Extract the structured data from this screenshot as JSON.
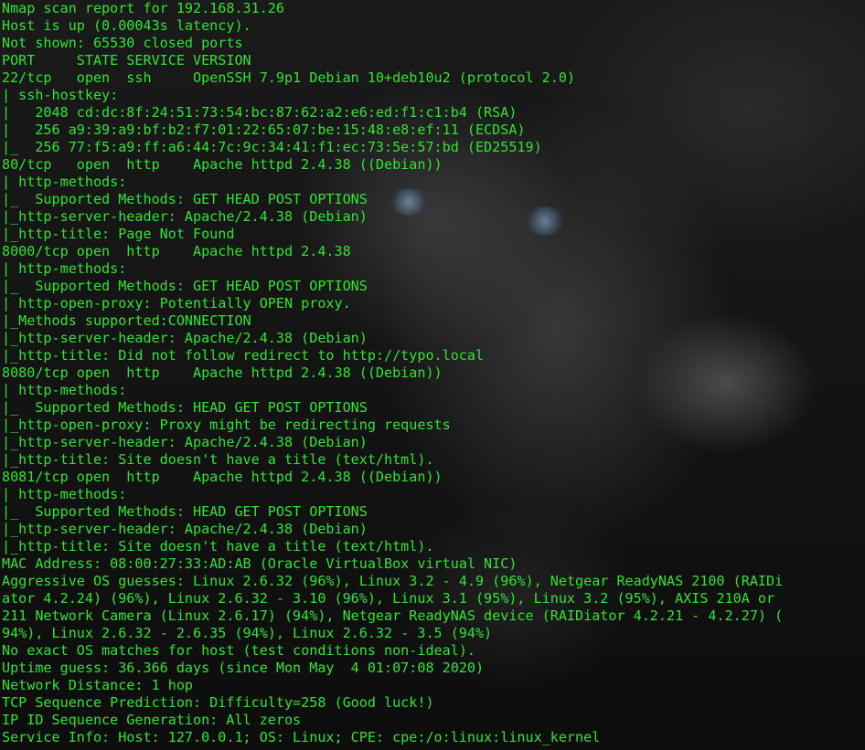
{
  "terminal": {
    "lines": [
      "Nmap scan report for 192.168.31.26",
      "Host is up (0.00043s latency).",
      "Not shown: 65530 closed ports",
      "PORT     STATE SERVICE VERSION",
      "22/tcp   open  ssh     OpenSSH 7.9p1 Debian 10+deb10u2 (protocol 2.0)",
      "| ssh-hostkey:",
      "|   2048 cd:dc:8f:24:51:73:54:bc:87:62:a2:e6:ed:f1:c1:b4 (RSA)",
      "|   256 a9:39:a9:bf:b2:f7:01:22:65:07:be:15:48:e8:ef:11 (ECDSA)",
      "|_  256 77:f5:a9:ff:a6:44:7c:9c:34:41:f1:ec:73:5e:57:bd (ED25519)",
      "80/tcp   open  http    Apache httpd 2.4.38 ((Debian))",
      "| http-methods:",
      "|_  Supported Methods: GET HEAD POST OPTIONS",
      "|_http-server-header: Apache/2.4.38 (Debian)",
      "|_http-title: Page Not Found",
      "8000/tcp open  http    Apache httpd 2.4.38",
      "| http-methods:",
      "|_  Supported Methods: GET HEAD POST OPTIONS",
      "| http-open-proxy: Potentially OPEN proxy.",
      "|_Methods supported:CONNECTION",
      "|_http-server-header: Apache/2.4.38 (Debian)",
      "|_http-title: Did not follow redirect to http://typo.local",
      "8080/tcp open  http    Apache httpd 2.4.38 ((Debian))",
      "| http-methods:",
      "|_  Supported Methods: HEAD GET POST OPTIONS",
      "|_http-open-proxy: Proxy might be redirecting requests",
      "|_http-server-header: Apache/2.4.38 (Debian)",
      "|_http-title: Site doesn't have a title (text/html).",
      "8081/tcp open  http    Apache httpd 2.4.38 ((Debian))",
      "| http-methods:",
      "|_  Supported Methods: HEAD GET POST OPTIONS",
      "|_http-server-header: Apache/2.4.38 (Debian)",
      "|_http-title: Site doesn't have a title (text/html).",
      "MAC Address: 08:00:27:33:AD:AB (Oracle VirtualBox virtual NIC)",
      "Aggressive OS guesses: Linux 2.6.32 (96%), Linux 3.2 - 4.9 (96%), Netgear ReadyNAS 2100 (RAIDi",
      "ator 4.2.24) (96%), Linux 2.6.32 - 3.10 (96%), Linux 3.1 (95%), Linux 3.2 (95%), AXIS 210A or",
      "211 Network Camera (Linux 2.6.17) (94%), Netgear ReadyNAS device (RAIDiator 4.2.21 - 4.2.27) (",
      "94%), Linux 2.6.32 - 2.6.35 (94%), Linux 2.6.32 - 3.5 (94%)",
      "No exact OS matches for host (test conditions non-ideal).",
      "Uptime guess: 36.366 days (since Mon May  4 01:07:08 2020)",
      "Network Distance: 1 hop",
      "TCP Sequence Prediction: Difficulty=258 (Good luck!)",
      "IP ID Sequence Generation: All zeros",
      "Service Info: Host: 127.0.0.1; OS: Linux; CPE: cpe:/o:linux:linux_kernel"
    ]
  },
  "colors": {
    "text": "#2fe42f",
    "background": "#0c0c0c"
  }
}
